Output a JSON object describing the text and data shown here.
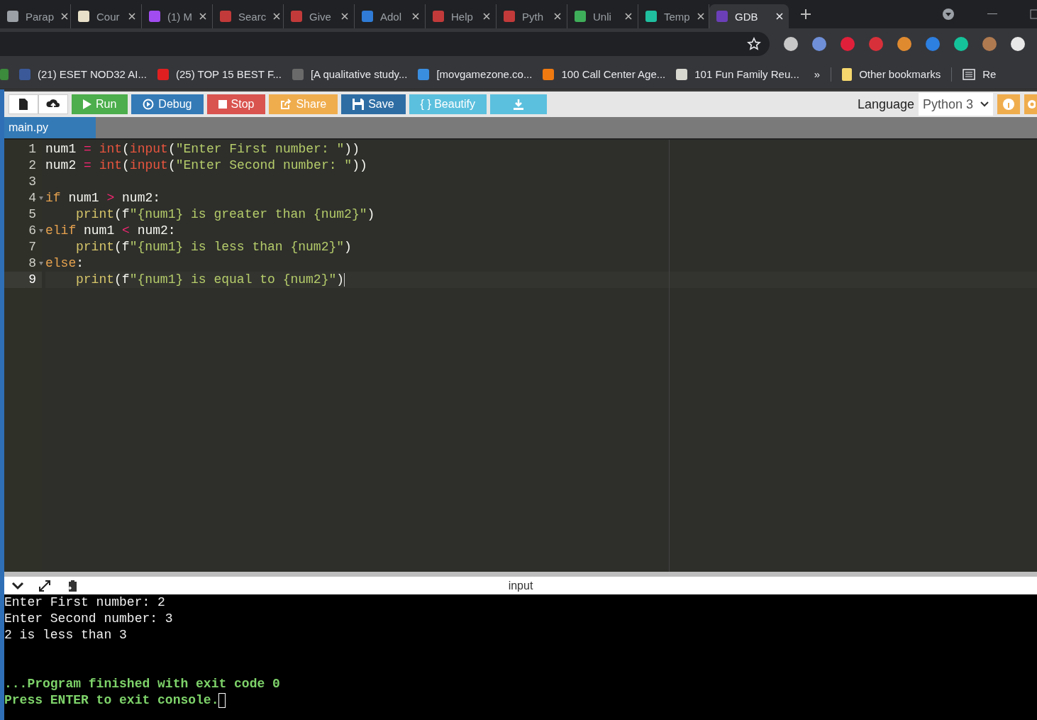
{
  "browser_tabs": [
    {
      "title": "Parap",
      "color": "#9aa0a6",
      "selected": false
    },
    {
      "title": "Cour",
      "color": "#e8e0c8",
      "selected": false
    },
    {
      "title": "(1) M",
      "color": "#a14cf0",
      "selected": false
    },
    {
      "title": "Searc",
      "color": "#c23a3a",
      "selected": false
    },
    {
      "title": "Give",
      "color": "#c23a3a",
      "selected": false
    },
    {
      "title": "Adol",
      "color": "#2f7bd6",
      "selected": false
    },
    {
      "title": "Help",
      "color": "#c23a3a",
      "selected": false
    },
    {
      "title": "Pyth",
      "color": "#c23a3a",
      "selected": false
    },
    {
      "title": "Unli",
      "color": "#3fae5a",
      "selected": false
    },
    {
      "title": "Temp",
      "color": "#1fbfa0",
      "selected": false
    },
    {
      "title": "GDB",
      "color": "#6b3fb8",
      "selected": true
    }
  ],
  "bookmarks": [
    {
      "title": "(21) ESET NOD32 AI...",
      "color": "#3b5998"
    },
    {
      "title": "(25) TOP 15 BEST F...",
      "color": "#e02020"
    },
    {
      "title": "[A qualitative study...",
      "color": "#6a6a6a"
    },
    {
      "title": "[movgamezone.co...",
      "color": "#3a8ee0"
    },
    {
      "title": "100 Call Center Age...",
      "color": "#f07a10"
    },
    {
      "title": "101 Fun Family Reu...",
      "color": "#d8d8d0"
    }
  ],
  "bookmarks_more": "»",
  "other_bookmarks": "Other bookmarks",
  "reading_list": "Re",
  "toolbar": {
    "buttons": [
      {
        "label": "Run",
        "kind": "run"
      },
      {
        "label": "Debug",
        "kind": "debug"
      },
      {
        "label": "Stop",
        "kind": "stop"
      },
      {
        "label": "Share",
        "kind": "share"
      },
      {
        "label": "Save",
        "kind": "save"
      },
      {
        "label": "{ } Beautify",
        "kind": "beautify"
      },
      {
        "kind": "download"
      }
    ],
    "language_label": "Language",
    "language": "Python 3"
  },
  "file_tab": {
    "name": "main.py",
    "selected": true
  },
  "code": [
    {
      "n": "1",
      "current": false,
      "indent": false,
      "tokens": [
        {
          "t": "num1 ",
          "kind": "plain"
        },
        {
          "t": "=",
          "kind": "op"
        },
        {
          "t": " int",
          "kind": "builtin"
        },
        {
          "t": "(",
          "kind": "plain"
        },
        {
          "t": "input",
          "kind": "builtin"
        },
        {
          "t": "(",
          "kind": "plain"
        },
        {
          "t": "\"Enter First number: \"",
          "kind": "str"
        },
        {
          "t": "))",
          "kind": "plain"
        }
      ]
    },
    {
      "n": "2",
      "current": false,
      "indent": false,
      "tokens": [
        {
          "t": "num2 ",
          "kind": "plain"
        },
        {
          "t": "=",
          "kind": "op"
        },
        {
          "t": " int",
          "kind": "builtin"
        },
        {
          "t": "(",
          "kind": "plain"
        },
        {
          "t": "input",
          "kind": "builtin"
        },
        {
          "t": "(",
          "kind": "plain"
        },
        {
          "t": "\"Enter Second number: \"",
          "kind": "str"
        },
        {
          "t": "))",
          "kind": "plain"
        }
      ]
    },
    {
      "n": "3",
      "current": false
    },
    {
      "n": "4",
      "current": false,
      "indent": false,
      "fold": true,
      "tokens": [
        {
          "t": "if",
          "kind": "kw"
        },
        {
          "t": " num1 ",
          "kind": "plain"
        },
        {
          "t": ">",
          "kind": "op"
        },
        {
          "t": " num2:",
          "kind": "plain"
        }
      ]
    },
    {
      "n": "5",
      "current": false,
      "indent": true,
      "tokens": [
        {
          "t": "print",
          "kind": "fn"
        },
        {
          "t": "(f",
          "kind": "plain"
        },
        {
          "t": "\"{num1} is greater than {num2}\"",
          "kind": "str"
        },
        {
          "t": ")",
          "kind": "plain"
        }
      ]
    },
    {
      "n": "6",
      "current": false,
      "indent": false,
      "fold": true,
      "tokens": [
        {
          "t": "elif",
          "kind": "kw"
        },
        {
          "t": " num1 ",
          "kind": "plain"
        },
        {
          "t": "<",
          "kind": "op"
        },
        {
          "t": " num2:",
          "kind": "plain"
        }
      ]
    },
    {
      "n": "7",
      "current": false,
      "indent": true,
      "tokens": [
        {
          "t": "print",
          "kind": "fn"
        },
        {
          "t": "(f",
          "kind": "plain"
        },
        {
          "t": "\"{num1} is less than {num2}\"",
          "kind": "str"
        },
        {
          "t": ")",
          "kind": "plain"
        }
      ]
    },
    {
      "n": "8",
      "current": false,
      "indent": false,
      "fold": true,
      "tokens": [
        {
          "t": "else",
          "kind": "kw"
        },
        {
          "t": ":",
          "kind": "plain"
        }
      ]
    },
    {
      "n": "9",
      "current": true,
      "indent": true,
      "tokens": [
        {
          "t": "print",
          "kind": "fn"
        },
        {
          "t": "(f",
          "kind": "plain"
        },
        {
          "t": "\"{num1} is equal to {num2}\"",
          "kind": "str"
        },
        {
          "t": ")",
          "kind": "plain"
        }
      ]
    }
  ],
  "console": {
    "title": "input",
    "lines": [
      {
        "text": "Enter First number: 2",
        "kind": "output"
      },
      {
        "text": "Enter Second number: 3",
        "kind": "output"
      },
      {
        "text": "2 is less than 3",
        "kind": "output"
      },
      {
        "text": "...Program finished with exit code 0",
        "kind": "status"
      },
      {
        "text": "Press ENTER to exit console.",
        "kind": "status",
        "cursor": true
      }
    ]
  }
}
